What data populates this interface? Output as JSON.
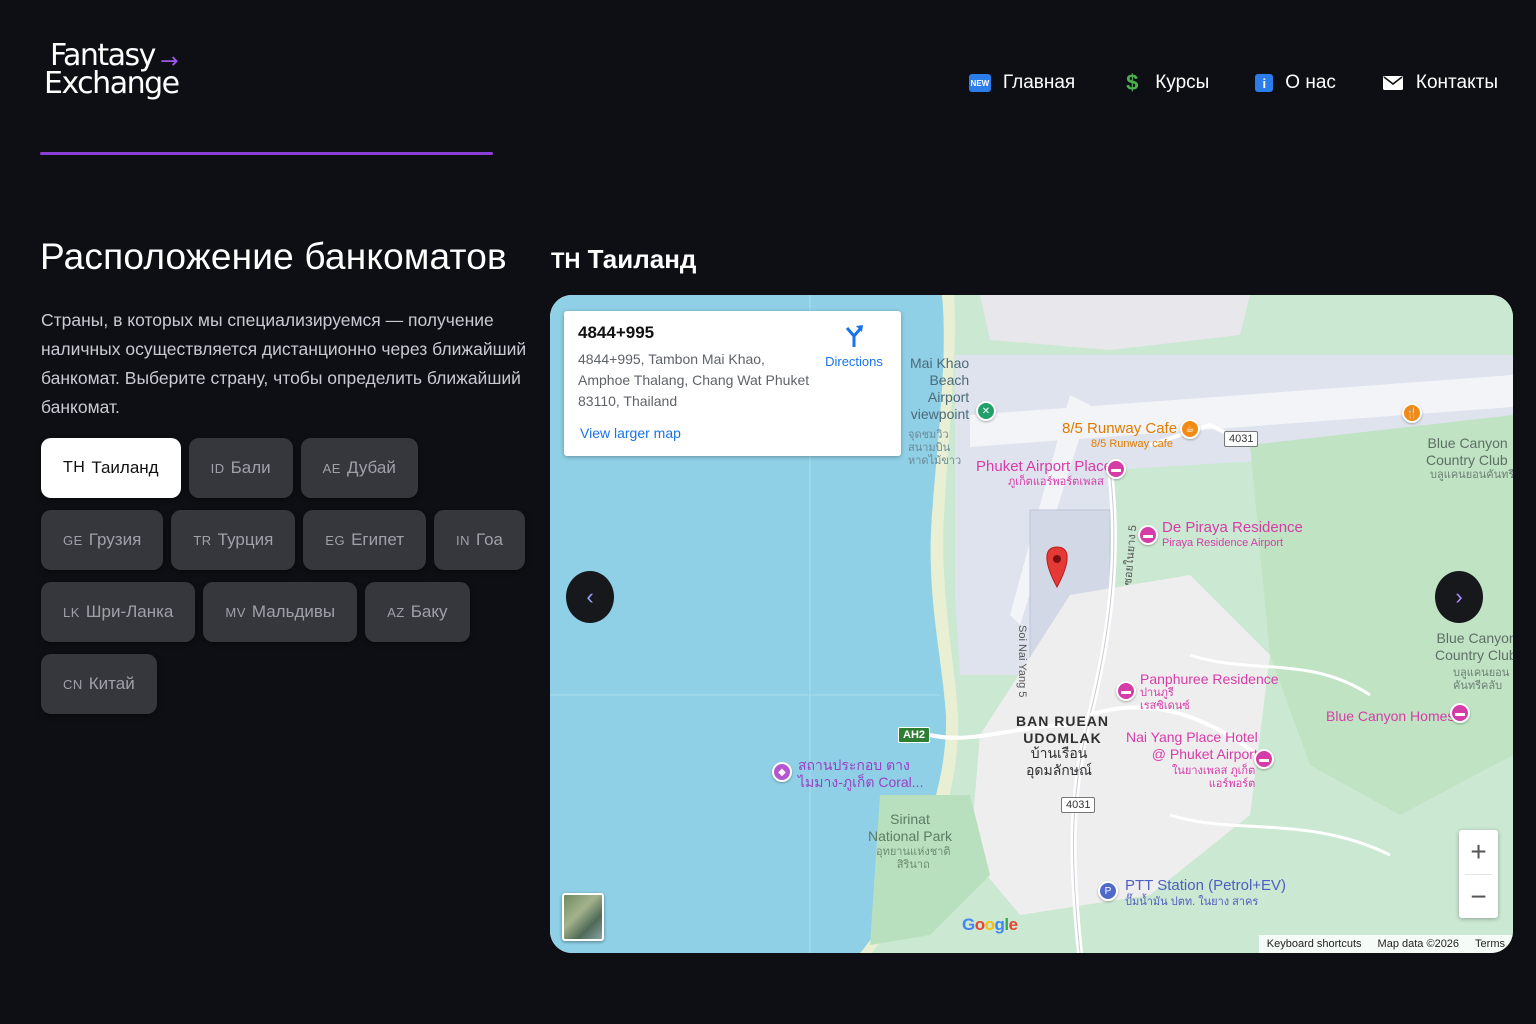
{
  "brand": {
    "line1": "Fantasy",
    "line2": "Exchange",
    "arrow": "→",
    "accent_color": "#8c3fd6"
  },
  "nav": [
    {
      "label": "Главная",
      "icon": "new-icon",
      "badge": "NEW"
    },
    {
      "label": "Курсы",
      "icon": "dollar-icon",
      "glyph": "$"
    },
    {
      "label": "О нас",
      "icon": "info-icon",
      "glyph": "i"
    },
    {
      "label": "Контакты",
      "icon": "mail-icon"
    }
  ],
  "section": {
    "title": "Расположение банкоматов",
    "description": "Страны, в которых мы специализируемся — получение наличных осуществляется дистанционно через ближайший банкомат. Выберите страну, чтобы определить ближайший банкомат."
  },
  "countries": [
    {
      "code": "TH",
      "label": "Таиланд",
      "active": true
    },
    {
      "code": "ID",
      "label": "Бали"
    },
    {
      "code": "AE",
      "label": "Дубай"
    },
    {
      "code": "GE",
      "label": "Грузия"
    },
    {
      "code": "TR",
      "label": "Турция"
    },
    {
      "code": "EG",
      "label": "Египет"
    },
    {
      "code": "IN",
      "label": "Гоа"
    },
    {
      "code": "LK",
      "label": "Шри-Ланка"
    },
    {
      "code": "MV",
      "label": "Мальдивы"
    },
    {
      "code": "AZ",
      "label": "Баку"
    },
    {
      "code": "CN",
      "label": "Китай"
    }
  ],
  "selected": {
    "code": "TH",
    "label": "Таиланд"
  },
  "map": {
    "card": {
      "plus_code": "4844+995",
      "address": "4844+995, Tambon Mai Khao, Amphoe Thalang, Chang Wat Phuket 83110, Thailand",
      "directions": "Directions",
      "larger_map": "View larger map"
    },
    "labels": {
      "viewpoint": "Mai Khao\nBeach\nAirport\nviewpoint",
      "viewpoint_th": "จุดชมวิว\nสนามบิน\nหาดไม้ขาว",
      "runway_cafe": "8/5 Runway Cafe",
      "runway_cafe_sub": "8/5 Runway cafe",
      "airport_place": "Phuket Airport Place",
      "airport_place_th": "ภูเก็ตแอร์พอร์ตเพลส",
      "blue_canyon_1": "Blue Canyon\nCountry Club",
      "blue_canyon_1_th": "บลูแคนยอนคันทรีคลับ",
      "de_piraya": "De Piraya Residence",
      "de_piraya_sub": "Piraya Residence Airport",
      "soi": "Soi Nai Yang 5",
      "soi_th": "ซอยในยาง 5",
      "blue_canyon_2": "Blue Canyon\nCountry Club",
      "blue_canyon_2_th": "บลูแคนยอน\nคันทรีคลับ",
      "panphuree": "Panphuree Residence",
      "panphuree_th": "ปานภูรี\nเรสซิเดนซ์",
      "blue_canyon_homes": "Blue Canyon Homes 2",
      "ban_ruean": "BAN RUEAN\nUDOMLAK",
      "ban_ruean_th": "บ้านเรือน\nอุดมลักษณ์",
      "nai_yang_hotel": "Nai Yang Place Hotel\n@ Phuket Airport",
      "nai_yang_hotel_th": "ในยางเพลส ภูเก็ต\nแอร์พอร์ต",
      "coral": "สถานประกอบ ตาง\nไมมาง-ภูเก็ต Coral...",
      "sirinat": "Sirinat\nNational Park",
      "sirinat_th": "อุทยานแห่งชาติ\nสิรินาถ",
      "ptt": "PTT Station (Petrol+EV)",
      "ptt_th": "ปั๊มน้ำมัน ปตท. ในยาง สาคร",
      "route_ah2": "AH2",
      "route_4031_a": "4031",
      "route_4031_b": "4031"
    },
    "google": "Google",
    "attribution": [
      "Keyboard shortcuts",
      "Map data ©2026",
      "Terms"
    ],
    "zoom_in": "+",
    "zoom_out": "−",
    "prev": "‹",
    "next": "›",
    "colors": {
      "water": "#8fd0e6",
      "land": "#cbe8d2",
      "airport": "#dfe3ee",
      "runway": "#f3f4f8",
      "poi_pink": "#d63ca8",
      "poi_orange": "#f28a16",
      "pin": "#e53935"
    }
  }
}
